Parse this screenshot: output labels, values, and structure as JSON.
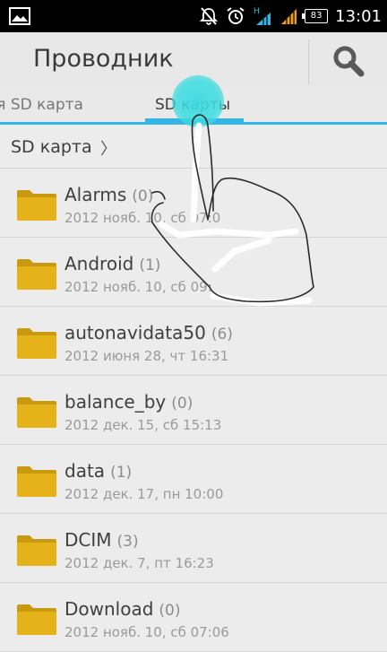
{
  "status_bar": {
    "time": "13:01",
    "battery": "83",
    "network_label": "H",
    "icons": [
      "image-icon",
      "mute-icon",
      "alarm-icon",
      "signal-h-icon",
      "signal-icon",
      "battery-icon"
    ]
  },
  "header": {
    "title": "Проводник",
    "search_icon": "search-icon"
  },
  "tabs": [
    {
      "label": "яя SD карта",
      "selected": false
    },
    {
      "label": "SD карты",
      "selected": true
    }
  ],
  "breadcrumb": {
    "label": "SD карта",
    "separator": "〉"
  },
  "files": [
    {
      "name": "Alarms",
      "count": "(0)",
      "meta": "2012 нояб. 10, сб 07:0"
    },
    {
      "name": "Android",
      "count": "(1)",
      "meta": "2012 нояб. 10, сб 09:"
    },
    {
      "name": "autonavidata50",
      "count": "(6)",
      "meta": "2012 июня 28, чт 16:31"
    },
    {
      "name": "balance_by",
      "count": "(0)",
      "meta": "2012 дек. 15, сб 15:13"
    },
    {
      "name": "data",
      "count": "(1)",
      "meta": "2012 дек. 17, пн 10:00"
    },
    {
      "name": "DCIM",
      "count": "(3)",
      "meta": "2012 дек. 7, пт 16:23"
    },
    {
      "name": "Download",
      "count": "(0)",
      "meta": "2012 нояб. 10, сб 07:06"
    }
  ],
  "colors": {
    "accent": "#33b5e5",
    "folder": "#e5b21a",
    "tap": "#3cdce1"
  }
}
